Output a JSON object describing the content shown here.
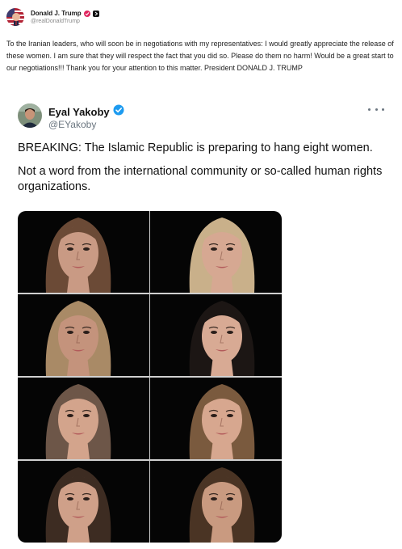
{
  "post": {
    "author": "Donald J. Trump",
    "handle": "@realDonaldTrump",
    "text": "To the Iranian leaders, who will soon be in negotiations with my representatives: I would greatly appreciate the release of these women. I am sure that they will respect the fact that you did so. Please do them no harm! Would be a great start to our negotiations!!! Thank you for your attention to this matter. President DONALD J. TRUMP"
  },
  "quoted": {
    "author": "Eyal Yakoby",
    "handle": "@EYakoby",
    "paragraph_1": "BREAKING: The Islamic Republic is preparing to hang eight women.",
    "paragraph_2": "Not a word from the international community or so-called human rights organizations."
  },
  "icons": {
    "verified": "verified-badge-icon",
    "more": "more-options-icon"
  },
  "colors": {
    "verified_blue": "#1d9bf0",
    "handle_gray": "#6b7680",
    "photo_background": "#050505"
  },
  "photos": [
    {
      "hair": "#6b4a36",
      "skin": "#c99a84"
    },
    {
      "hair": "#c9b08a",
      "skin": "#d6a892"
    },
    {
      "hair": "#a98a66",
      "skin": "#c4937c"
    },
    {
      "hair": "#1c1614",
      "skin": "#d8aa94"
    },
    {
      "hair": "#6d5648",
      "skin": "#d3a48c"
    },
    {
      "hair": "#7a5a3e",
      "skin": "#d7a78f"
    },
    {
      "hair": "#3d2c22",
      "skin": "#cfa089"
    },
    {
      "hair": "#4a3424",
      "skin": "#c99a80"
    }
  ]
}
